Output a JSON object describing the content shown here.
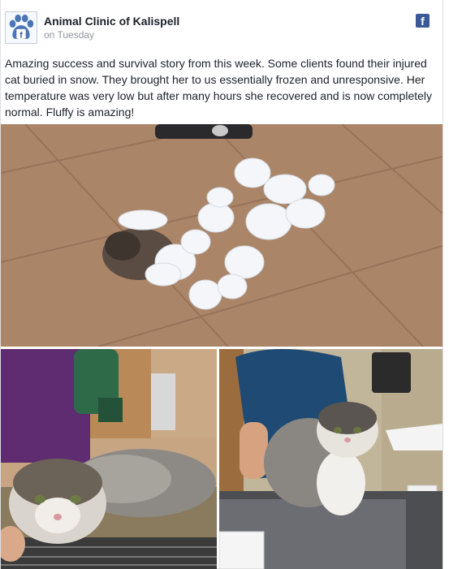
{
  "post": {
    "page_name": "Animal Clinic of Kalispell",
    "timestamp": "on Tuesday",
    "text": "Amazing success and survival story from this week. Some clients found their injured cat buried in snow. They brought her to us essentially frozen and unresponsive. Her temperature was very low but after many hours she recovered and is now completely normal. Fluffy is amazing!",
    "avatar_icon": "paw-print-icon",
    "network_icon": "facebook-icon",
    "network_letter": "f"
  },
  "photos": [
    {
      "name": "snow-covered-cat-photo",
      "subject": "cat covered in clumps of snow on tile floor"
    },
    {
      "name": "cat-being-blow-dried-photo",
      "subject": "wet cat lying on towel while being dried"
    },
    {
      "name": "recovered-cat-on-table-photo",
      "subject": "fluffy cat standing on exam table with staff"
    }
  ],
  "colors": {
    "accent": "#3b5998",
    "name_text": "#1d2129",
    "meta_text": "#90949c",
    "paw": "#4a76b8"
  }
}
